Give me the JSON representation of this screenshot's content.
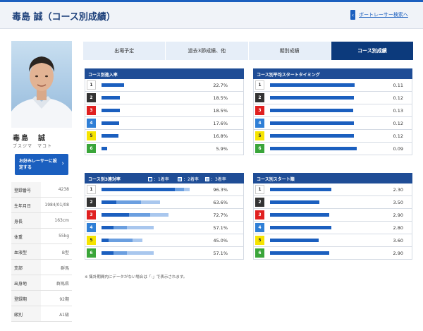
{
  "header": {
    "title": "毒島 誠（コース別成績）",
    "back_link": "ボートレーサー検索へ",
    "back_glyph": "‹"
  },
  "racer": {
    "name": "毒島　誠",
    "kana": "ブスジマ　マコト",
    "favorite_label": "お好みレーサーに設定する",
    "favorite_arrow": "›"
  },
  "profile": [
    {
      "key": "登録番号",
      "value": "4238"
    },
    {
      "key": "生年月日",
      "value": "1984/01/08"
    },
    {
      "key": "身長",
      "value": "163cm"
    },
    {
      "key": "体重",
      "value": "55kg"
    },
    {
      "key": "血液型",
      "value": "B型"
    },
    {
      "key": "支部",
      "value": "群馬"
    },
    {
      "key": "出身地",
      "value": "群馬県"
    },
    {
      "key": "登録期",
      "value": "92期"
    },
    {
      "key": "級別",
      "value": "A1級"
    }
  ],
  "tabs": [
    {
      "label": "出場予定",
      "active": false
    },
    {
      "label": "過去3節成績、他",
      "active": false
    },
    {
      "label": "期別成績",
      "active": false
    },
    {
      "label": "コース別成績",
      "active": true
    }
  ],
  "lane_colors": {
    "1": {
      "bg": "#ffffff",
      "fg": "#333333",
      "border": "#cccccc"
    },
    "2": {
      "bg": "#333333",
      "fg": "#ffffff"
    },
    "3": {
      "bg": "#e02020",
      "fg": "#ffffff"
    },
    "4": {
      "bg": "#2f7fd6",
      "fg": "#ffffff"
    },
    "5": {
      "bg": "#f6e400",
      "fg": "#333333"
    },
    "6": {
      "bg": "#3aa53a",
      "fg": "#ffffff"
    }
  },
  "bar_colors": {
    "primary": "#1b5fbf",
    "second": "#6b9fe0",
    "third": "#a9c7ee"
  },
  "panels": {
    "entry_rate": {
      "title": "コース別進入率",
      "rows": [
        {
          "lane": "1",
          "fraction": 0.227,
          "value": "22.7%"
        },
        {
          "lane": "2",
          "fraction": 0.185,
          "value": "18.5%"
        },
        {
          "lane": "3",
          "fraction": 0.185,
          "value": "18.5%"
        },
        {
          "lane": "4",
          "fraction": 0.176,
          "value": "17.6%"
        },
        {
          "lane": "5",
          "fraction": 0.168,
          "value": "16.8%"
        },
        {
          "lane": "6",
          "fraction": 0.059,
          "value": "5.9%"
        }
      ]
    },
    "start_timing": {
      "title": "コース別平均スタートタイミング",
      "rows": [
        {
          "lane": "1",
          "fraction": 0.86,
          "value": "0.11"
        },
        {
          "lane": "2",
          "fraction": 0.85,
          "value": "0.12"
        },
        {
          "lane": "3",
          "fraction": 0.84,
          "value": "0.13"
        },
        {
          "lane": "4",
          "fraction": 0.85,
          "value": "0.12"
        },
        {
          "lane": "5",
          "fraction": 0.85,
          "value": "0.12"
        },
        {
          "lane": "6",
          "fraction": 0.88,
          "value": "0.09"
        }
      ]
    },
    "rentai_rate": {
      "title": "コース別3連対率",
      "legend": [
        "：1着率",
        "：2着率",
        "：3着率"
      ],
      "rows": [
        {
          "lane": "1",
          "first": 0.8,
          "second": 0.1,
          "third": 0.063,
          "value": "96.3%"
        },
        {
          "lane": "2",
          "first": 0.16,
          "second": 0.27,
          "third": 0.206,
          "value": "63.6%"
        },
        {
          "lane": "3",
          "first": 0.3,
          "second": 0.23,
          "third": 0.197,
          "value": "72.7%"
        },
        {
          "lane": "4",
          "first": 0.13,
          "second": 0.15,
          "third": 0.291,
          "value": "57.1%"
        },
        {
          "lane": "5",
          "first": 0.08,
          "second": 0.26,
          "third": 0.11,
          "value": "45.0%"
        },
        {
          "lane": "6",
          "first": 0.13,
          "second": 0.15,
          "third": 0.291,
          "value": "57.1%"
        }
      ]
    },
    "start_rank": {
      "title": "コース別スタート順",
      "rows": [
        {
          "lane": "1",
          "fraction": 0.62,
          "value": "2.30"
        },
        {
          "lane": "2",
          "fraction": 0.5,
          "value": "3.50"
        },
        {
          "lane": "3",
          "fraction": 0.6,
          "value": "2.90"
        },
        {
          "lane": "4",
          "fraction": 0.62,
          "value": "2.80"
        },
        {
          "lane": "5",
          "fraction": 0.49,
          "value": "3.60"
        },
        {
          "lane": "6",
          "fraction": 0.6,
          "value": "2.90"
        }
      ]
    }
  },
  "note": "※ 集計期間内にデータがない場合は「-」で表示されます。"
}
